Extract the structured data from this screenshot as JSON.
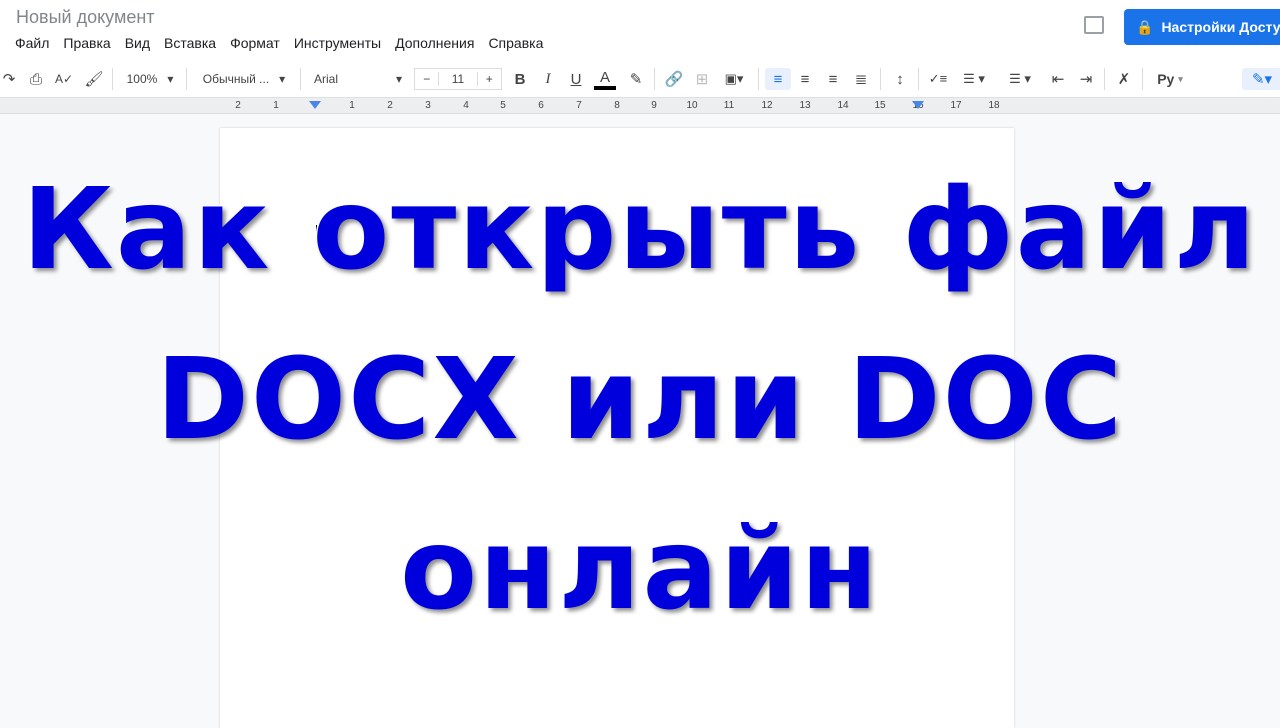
{
  "title": "Новый документ",
  "menu": [
    "Файл",
    "Правка",
    "Вид",
    "Вставка",
    "Формат",
    "Инструменты",
    "Дополнения",
    "Справка"
  ],
  "share_label": "Настройки Доступа",
  "toolbar": {
    "zoom": "100%",
    "style": "Обычный ...",
    "font": "Arial",
    "font_size": "11",
    "minus": "−",
    "plus": "+",
    "bold": "B",
    "italic": "I",
    "underline": "U",
    "text_color": "A",
    "spellcheck": "Pу"
  },
  "ruler": [
    "2",
    "1",
    "1",
    "2",
    "3",
    "4",
    "5",
    "6",
    "7",
    "8",
    "9",
    "10",
    "11",
    "12",
    "13",
    "14",
    "15",
    "16",
    "17",
    "18"
  ],
  "headline": [
    "Как открыть файл",
    "DOCX или DOC",
    "онлайн"
  ],
  "colors": {
    "accent": "#1a73e8",
    "headline": "#0000dd"
  }
}
